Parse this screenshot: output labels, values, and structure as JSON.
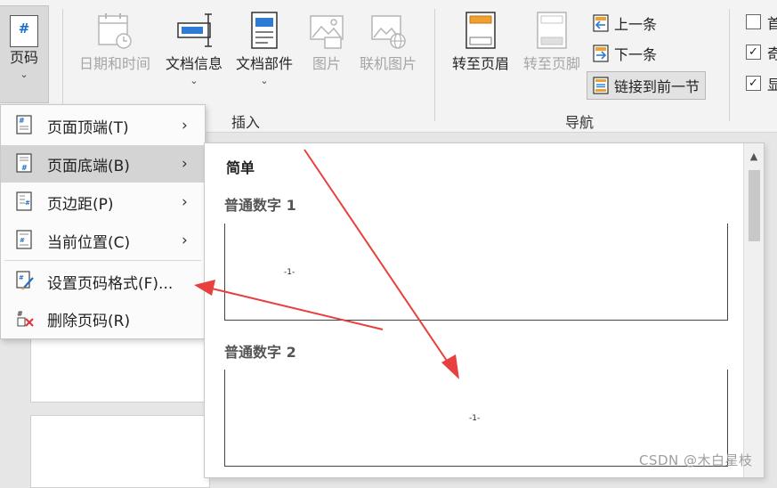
{
  "ribbon": {
    "page_number": {
      "label": "页码",
      "chevron": "⌄",
      "icon": "page-number-icon"
    },
    "header_footer_group": {
      "buttons": [
        {
          "label": "日期和时间",
          "enabled": false,
          "icon": "calendar-clock-icon"
        },
        {
          "label": "文档信息",
          "enabled": true,
          "icon": "document-info-icon",
          "chevron": "⌄"
        },
        {
          "label": "文档部件",
          "enabled": true,
          "icon": "document-parts-icon",
          "chevron": "⌄"
        },
        {
          "label": "图片",
          "enabled": false,
          "icon": "picture-icon"
        },
        {
          "label": "联机图片",
          "enabled": false,
          "icon": "online-picture-icon"
        }
      ],
      "group_label": "插入"
    },
    "navigation_group": {
      "goto_header": {
        "label": "转至页眉",
        "enabled": true,
        "icon": "goto-header-icon"
      },
      "goto_footer": {
        "label": "转至页脚",
        "enabled": false,
        "icon": "goto-footer-icon"
      },
      "previous": {
        "label": "上一条",
        "icon": "previous-section-icon"
      },
      "next": {
        "label": "下一条",
        "icon": "next-section-icon"
      },
      "link_to_previous": {
        "label": "链接到前一节",
        "icon": "link-previous-icon",
        "active": true
      },
      "group_label": "导航"
    },
    "options_group": {
      "checkboxes": [
        {
          "label": "首",
          "checked": false
        },
        {
          "label": "奇",
          "checked": true
        },
        {
          "label": "显",
          "checked": true
        }
      ]
    }
  },
  "page_number_menu": {
    "items": [
      {
        "label": "页面顶端(T)",
        "has_submenu": true,
        "highlighted": false,
        "icon": "page-top-icon"
      },
      {
        "label": "页面底端(B)",
        "has_submenu": true,
        "highlighted": true,
        "icon": "page-bottom-icon"
      },
      {
        "label": "页边距(P)",
        "has_submenu": true,
        "highlighted": false,
        "icon": "page-margin-icon"
      },
      {
        "label": "当前位置(C)",
        "has_submenu": true,
        "highlighted": false,
        "icon": "current-position-icon"
      },
      {
        "label": "设置页码格式(F)...",
        "has_submenu": false,
        "highlighted": false,
        "icon": "format-page-number-icon"
      },
      {
        "label": "删除页码(R)",
        "has_submenu": false,
        "highlighted": false,
        "icon": "remove-page-number-icon"
      }
    ],
    "submenu_arrow": "›"
  },
  "gallery": {
    "section_title": "简单",
    "items": [
      {
        "label": "普通数字 1",
        "preview_text": "-1-",
        "alignment": "left"
      },
      {
        "label": "普通数字 2",
        "preview_text": "-1-",
        "alignment": "center"
      }
    ],
    "scroll_up": "▲"
  },
  "annotation_color": "#e8403e",
  "watermark": "CSDN @木白星枝"
}
